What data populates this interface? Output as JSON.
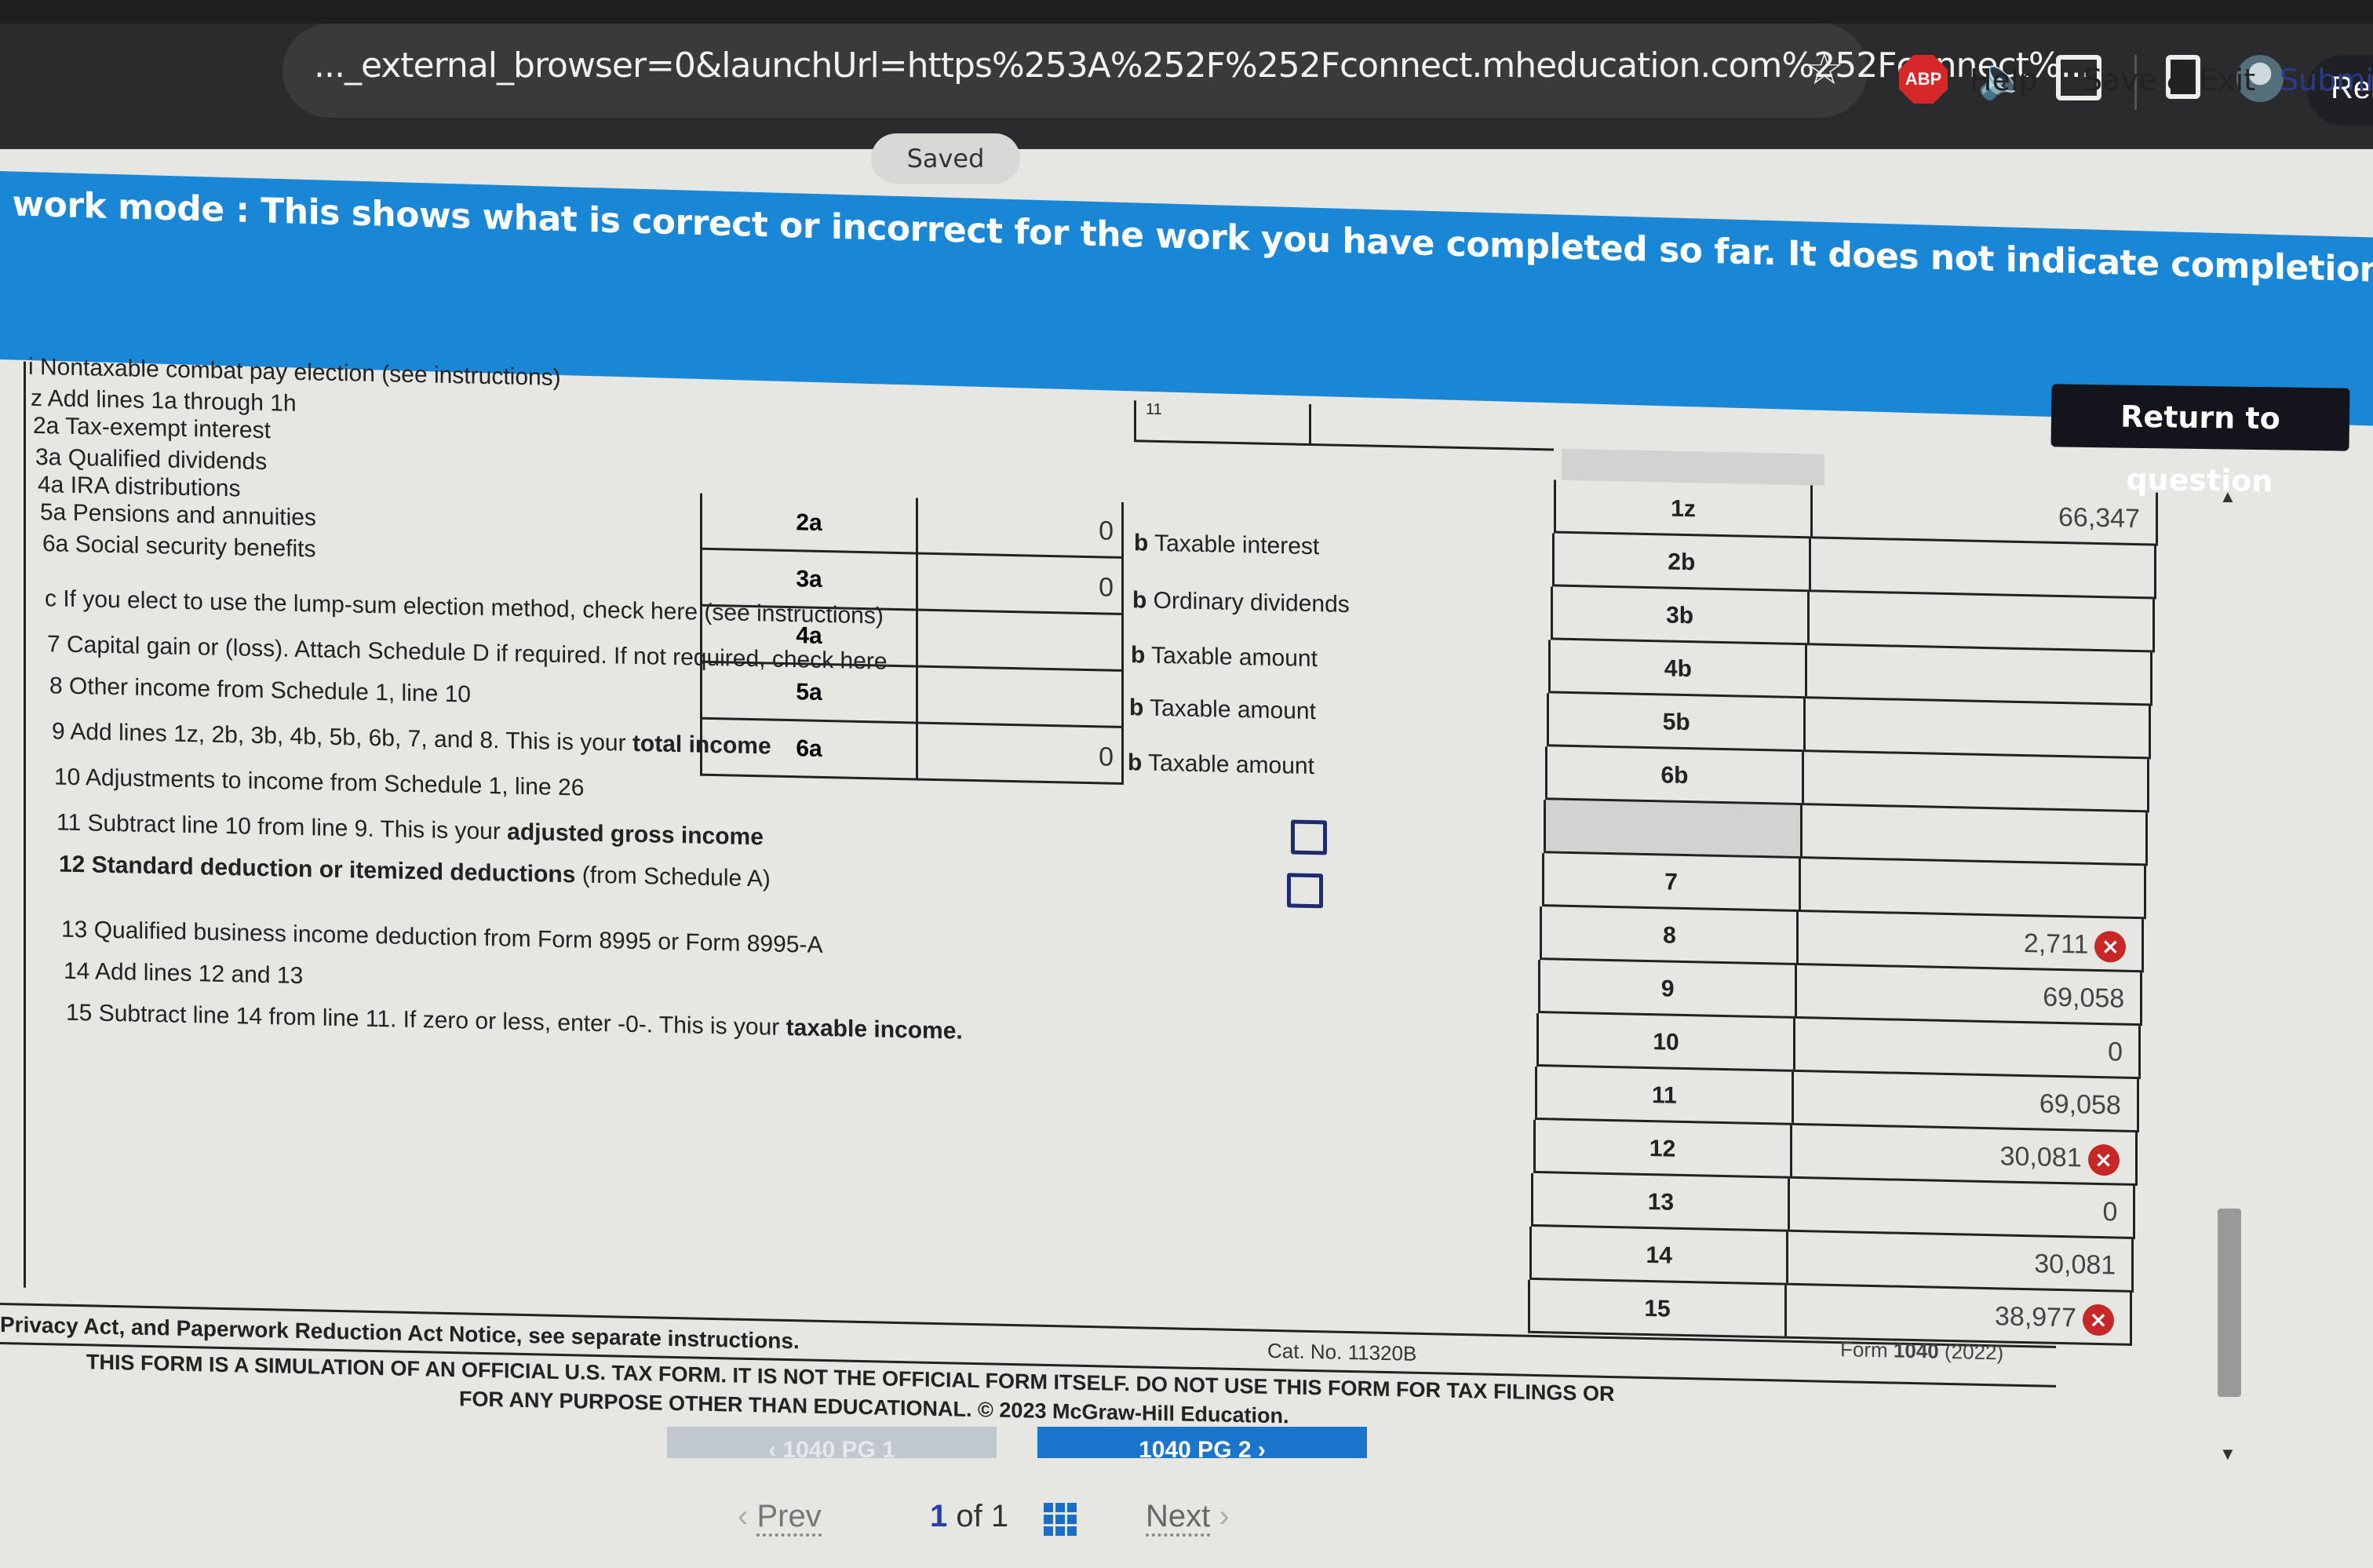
{
  "browser": {
    "url": "..._external_browser=0&launchUrl=https%253A%252F%252Fconnect.mheducation.com%252Fconnect%...",
    "bookmark_icon": "star-icon",
    "extensions": [
      "adblock-plus-icon",
      "speaker-icon",
      "puzzle-icon",
      "side-panel-icon",
      "profile-avatar"
    ],
    "abp_label": "ABP",
    "relaunch_label": "Rela"
  },
  "header": {
    "saved_label": "Saved",
    "help_label": "Help",
    "save_exit_label": "Save & Exit",
    "submit_label": "Submit"
  },
  "banner": {
    "text": "Check my work mode : This shows what is correct or incorrect for the work you have completed so far. It does not indicate completion."
  },
  "return_button": "Return to question",
  "form": {
    "left_lines": [
      {
        "key": "1i",
        "text": "i Nontaxable combat pay election (see instructions)"
      },
      {
        "key": "1z",
        "text": "z Add lines 1a through 1h"
      },
      {
        "key": "2a",
        "text": "2a Tax-exempt interest"
      },
      {
        "key": "3a",
        "text": "3a Qualified dividends"
      },
      {
        "key": "4a",
        "text": "4a IRA distributions"
      },
      {
        "key": "5a",
        "text": "5a Pensions and annuities"
      },
      {
        "key": "6a",
        "text": "6a Social security benefits"
      },
      {
        "key": "6c",
        "text": "c If you elect to use the lump-sum election method, check here (see instructions)"
      },
      {
        "key": "7",
        "text": "7 Capital gain or (loss). Attach Schedule D if required. If not required, check here"
      },
      {
        "key": "8",
        "text": "8 Other income from Schedule 1, line 10"
      },
      {
        "key": "9",
        "text": "9 Add lines 1z, 2b, 3b, 4b, 5b, 6b, 7, and 8. This is your",
        "bold": "total income"
      },
      {
        "key": "10",
        "text": "10 Adjustments to income from Schedule 1, line 26"
      },
      {
        "key": "11",
        "text": "11 Subtract line 10 from line 9. This is your",
        "bold": "adjusted gross income"
      },
      {
        "key": "12",
        "bold_prefix": "12 Standard deduction or itemized deductions",
        "text": "(from Schedule A)"
      },
      {
        "key": "13",
        "text": "13 Qualified business income deduction from Form 8995 or Form 8995-A"
      },
      {
        "key": "14",
        "text": "14 Add lines 12 and 13"
      },
      {
        "key": "15",
        "text": "15 Subtract line 14 from line 11. If zero or less, enter -0-. This is your",
        "bold": "taxable income."
      }
    ],
    "mid_rows": [
      {
        "code": "2a",
        "value": "0"
      },
      {
        "code": "3a",
        "value": "0"
      },
      {
        "code": "4a",
        "value": ""
      },
      {
        "code": "5a",
        "value": ""
      },
      {
        "code": "6a",
        "value": "0"
      }
    ],
    "b_labels": [
      {
        "prefix": "b",
        "text": "Taxable interest"
      },
      {
        "prefix": "b",
        "text": "Ordinary dividends"
      },
      {
        "prefix": "b",
        "text": "Taxable amount"
      },
      {
        "prefix": "b",
        "text": "Taxable amount"
      },
      {
        "prefix": "b",
        "text": "Taxable amount"
      }
    ],
    "line_1h_marker": "11",
    "right_rows": [
      {
        "code": "1z",
        "value": "66,347",
        "error": false
      },
      {
        "code": "2b",
        "value": "",
        "error": false
      },
      {
        "code": "3b",
        "value": "",
        "error": false
      },
      {
        "code": "4b",
        "value": "",
        "error": false
      },
      {
        "code": "5b",
        "value": "",
        "error": false
      },
      {
        "code": "6b",
        "value": "",
        "error": false
      },
      {
        "code": "",
        "value": "",
        "error": false,
        "shaded": true
      },
      {
        "code": "7",
        "value": "",
        "error": false
      },
      {
        "code": "8",
        "value": "2,711",
        "error": true
      },
      {
        "code": "9",
        "value": "69,058",
        "error": false
      },
      {
        "code": "10",
        "value": "0",
        "error": false
      },
      {
        "code": "11",
        "value": "69,058",
        "error": false
      },
      {
        "code": "12",
        "value": "30,081",
        "error": true
      },
      {
        "code": "13",
        "value": "0",
        "error": false
      },
      {
        "code": "14",
        "value": "30,081",
        "error": false
      },
      {
        "code": "15",
        "value": "38,977",
        "error": true
      }
    ],
    "checkboxes": [
      {
        "name": "lump-sum-election-checkbox",
        "checked": false
      },
      {
        "name": "schedule-d-not-required-checkbox",
        "checked": false
      }
    ],
    "error_icon": "x-circle-icon",
    "privacy_notice": "Privacy Act, and Paperwork Reduction Act Notice, see separate instructions.",
    "cat_no": "Cat. No. 11320B",
    "form_id_prefix": "Form",
    "form_id_num": "1040",
    "form_id_year": "(2022)",
    "disclaimer_line1": "THIS FORM IS A SIMULATION OF AN OFFICIAL U.S. TAX FORM. IT IS NOT THE OFFICIAL FORM ITSELF. DO NOT USE THIS FORM FOR TAX FILINGS OR",
    "disclaimer_line2": "FOR ANY PURPOSE OTHER THAN EDUCATIONAL. © 2023 McGraw-Hill Education."
  },
  "page_nav": {
    "prev_page_label": "‹  1040 PG 1",
    "next_page_label": "1040 PG 2  ›"
  },
  "pager": {
    "prev_label": "Prev",
    "current": "1",
    "of_label": "of",
    "total": "1",
    "next_label": "Next",
    "grid_icon": "grid-icon"
  },
  "colors": {
    "banner": "#1a86d6",
    "error": "#c62828",
    "next_button": "#1a75cc",
    "submit_link": "#2a3a8c"
  }
}
